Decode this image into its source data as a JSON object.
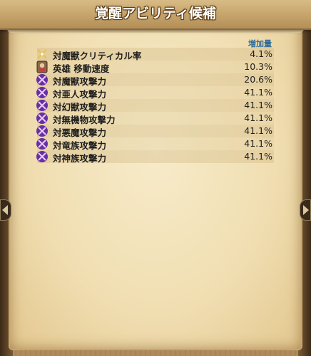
{
  "panel": {
    "title": "覚醒アビリティ候補",
    "column_header": "増加量"
  },
  "rows": [
    {
      "icon": "sword-icon",
      "name": "対魔獣クリティカル率",
      "value": "4.1%"
    },
    {
      "icon": "hero-icon",
      "name": "英雄 移動速度",
      "value": "10.3%"
    },
    {
      "icon": "sword-icon",
      "name": "対魔獣攻撃力",
      "value": "20.6%"
    },
    {
      "icon": "sword-icon",
      "name": "対亜人攻撃力",
      "value": "41.1%"
    },
    {
      "icon": "sword-icon",
      "name": "対幻獣攻撃力",
      "value": "41.1%"
    },
    {
      "icon": "sword-icon",
      "name": "対無機物攻撃力",
      "value": "41.1%"
    },
    {
      "icon": "sword-icon",
      "name": "対悪魔攻撃力",
      "value": "41.1%"
    },
    {
      "icon": "sword-icon",
      "name": "対竜族攻撃力",
      "value": "41.1%"
    },
    {
      "icon": "sword-icon",
      "name": "対神族攻撃力",
      "value": "41.1%"
    }
  ],
  "colors": {
    "header_text": "#2d6a9a",
    "parchment": "#f1dfb3",
    "icon_purple": "#8a3fc9",
    "icon_gold": "#e7c25a"
  }
}
